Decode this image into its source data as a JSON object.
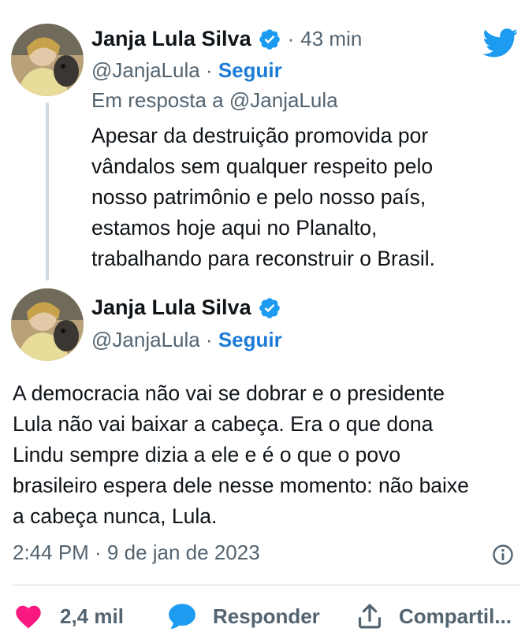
{
  "colors": {
    "accent": "#1d9bf0",
    "follow_link": "#1d7bd8",
    "like_heart": "#f91880",
    "muted_text": "#536471",
    "body_text": "#0f1419",
    "divider": "#cfd9de"
  },
  "header": {
    "logo_icon": "twitter-bird-icon"
  },
  "reply_tweet": {
    "author_name": "Janja Lula Silva",
    "verified_icon": "verified-badge-icon",
    "separator": "·",
    "time_ago": "43 min",
    "handle": "@JanjaLula",
    "handle_separator": " · ",
    "follow_label": "Seguir",
    "reply_to_label": "Em resposta a",
    "reply_to_handle": "@JanjaLula",
    "text": "Apesar da destruição promovida por\nvândalos sem qualquer respeito pelo\nnosso patrimônio e pelo nosso país,\nestamos hoje aqui no Planalto,\ntrabalhando para reconstruir o Brasil."
  },
  "main_tweet": {
    "author_name": "Janja Lula Silva",
    "verified_icon": "verified-badge-icon",
    "handle": "@JanjaLula",
    "handle_separator": " · ",
    "follow_label": "Seguir",
    "text": "A democracia não vai se dobrar e o presidente\nLula não vai baixar a cabeça. Era o que dona\nLindu sempre dizia a ele e é o que o povo\nbrasileiro espera dele nesse momento: não baixe\na cabeça nunca, Lula.",
    "timestamp": "2:44 PM · 9 de jan de 2023",
    "info_icon": "info-icon"
  },
  "actions": {
    "like": {
      "icon": "heart-icon",
      "label": "2,4 mil"
    },
    "reply": {
      "icon": "speech-bubble-icon",
      "label": "Responder"
    },
    "share": {
      "icon": "share-upload-icon",
      "label": "Compartil..."
    }
  }
}
